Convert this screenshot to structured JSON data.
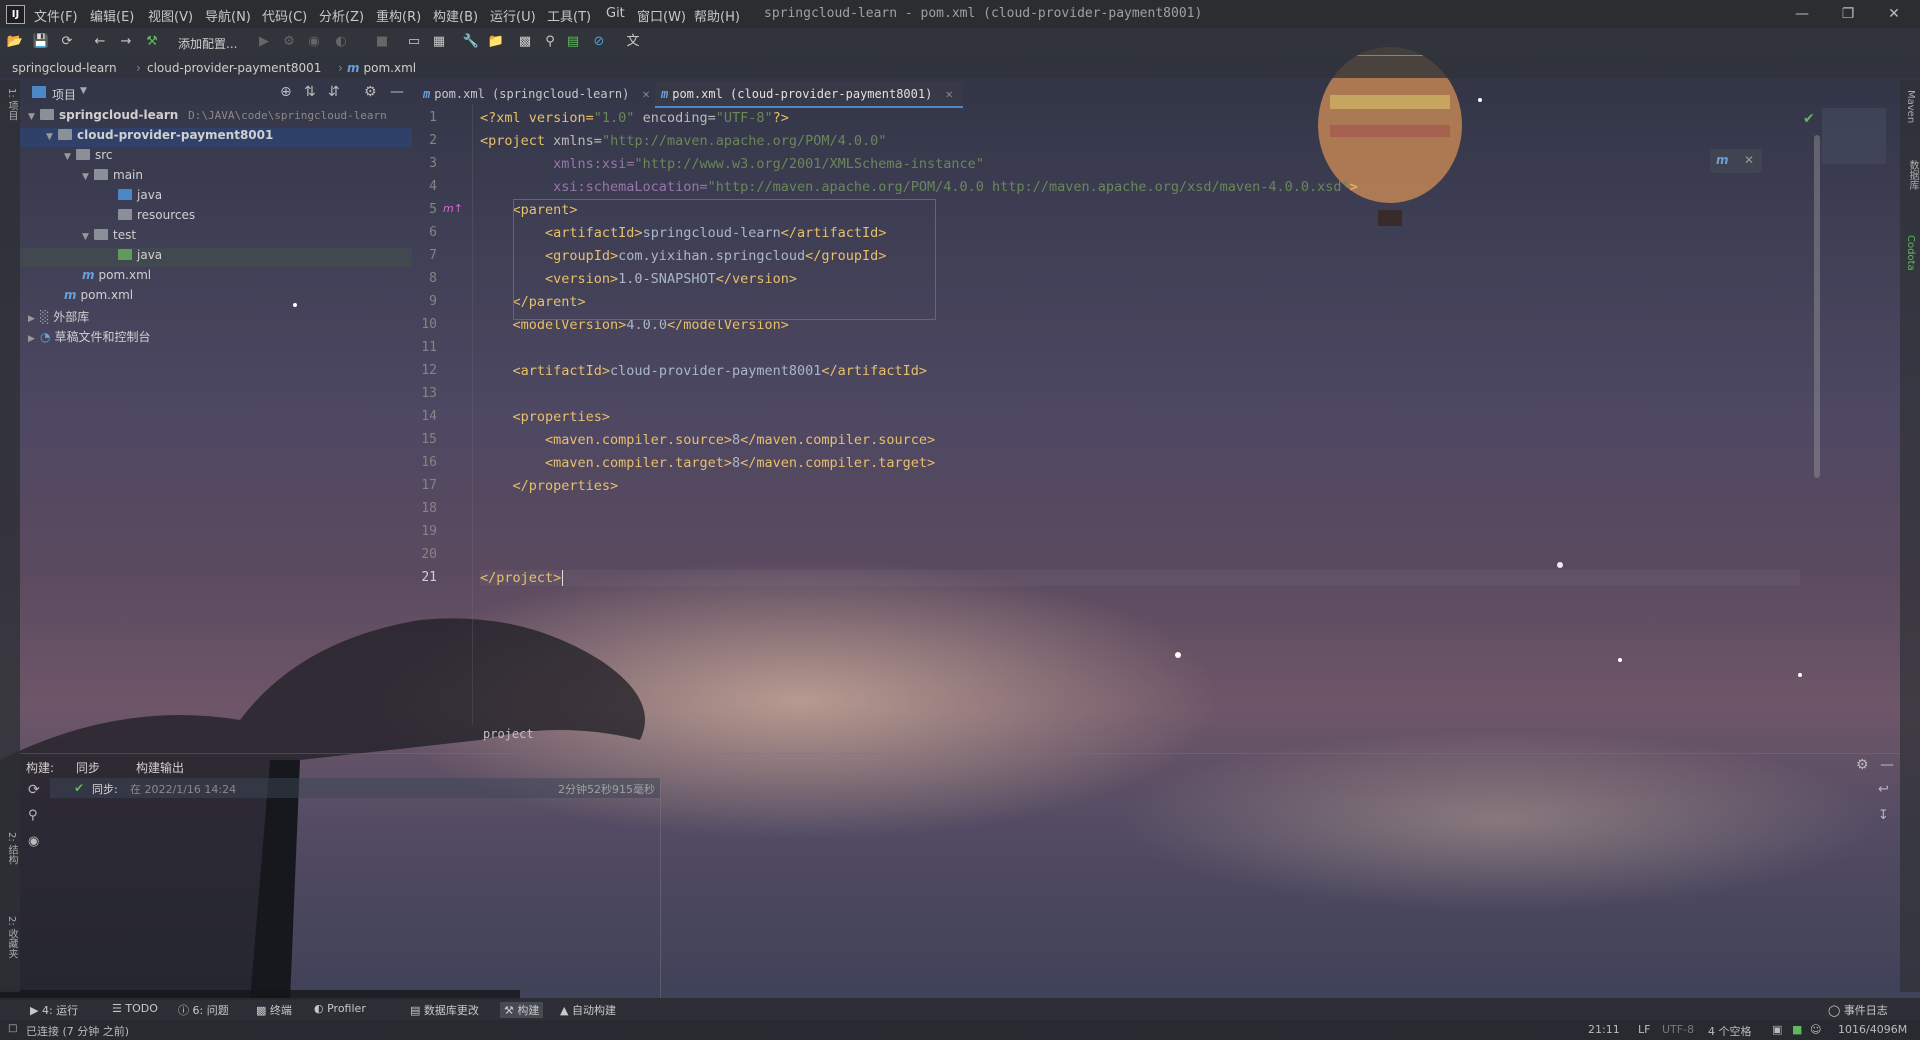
{
  "window": {
    "title": "springcloud-learn - pom.xml (cloud-provider-payment8001)",
    "logo": "IJ"
  },
  "menu": [
    "文件(F)",
    "编辑(E)",
    "视图(V)",
    "导航(N)",
    "代码(C)",
    "分析(Z)",
    "重构(R)",
    "构建(B)",
    "运行(U)",
    "工具(T)",
    "Git",
    "窗口(W)",
    "帮助(H)"
  ],
  "toolbar": {
    "add_config": "添加配置..."
  },
  "breadcrumb": [
    "springcloud-learn",
    "cloud-provider-payment8001",
    "pom.xml"
  ],
  "left_strip": {
    "project_label": "1: 项目",
    "structure_label": "2: 结构",
    "favorites_label": "2: 收藏夹"
  },
  "right_strip": {
    "maven_label": "Maven",
    "database_label": "数据库",
    "codota_label": "Codota"
  },
  "project_panel": {
    "title": "项目",
    "tree": [
      {
        "label": "springcloud-learn",
        "extra": "D:\\JAVA\\code\\springcloud-learn"
      },
      {
        "label": "cloud-provider-payment8001"
      },
      {
        "label": "src"
      },
      {
        "label": "main"
      },
      {
        "label": "java"
      },
      {
        "label": "resources"
      },
      {
        "label": "test"
      },
      {
        "label": "java"
      },
      {
        "label": "pom.xml"
      },
      {
        "label": "pom.xml"
      },
      {
        "label": "外部库"
      },
      {
        "label": "草稿文件和控制台"
      }
    ]
  },
  "editor": {
    "tabs": [
      {
        "label": "pom.xml (springcloud-learn)"
      },
      {
        "label": "pom.xml (cloud-provider-payment8001)"
      }
    ],
    "line_numbers": [
      "1",
      "2",
      "3",
      "4",
      "5",
      "6",
      "7",
      "8",
      "9",
      "10",
      "11",
      "12",
      "13",
      "14",
      "15",
      "16",
      "17",
      "18",
      "19",
      "20",
      "21"
    ],
    "lines": [
      {
        "p1": "<?xml version=",
        "p2": "\"1.0\"",
        "p3": " encoding=",
        "p4": "\"UTF-8\"",
        "p5": "?>"
      },
      {
        "p1": "<project ",
        "p2": "xmlns=",
        "p3": "\"http://maven.apache.org/POM/4.0.0\""
      },
      {
        "p1": "         xmlns:xsi=",
        "p2": "\"http://www.w3.org/2001/XMLSchema-instance\""
      },
      {
        "p1": "         xsi:schemaLocation=",
        "p2": "\"http://maven.apache.org/POM/4.0.0 http://maven.apache.org/xsd/maven-4.0.0.xsd\"",
        "p3": ">"
      },
      {
        "p1": "    <parent>"
      },
      {
        "p1": "        <artifactId>",
        "p2": "springcloud-learn",
        "p3": "</artifactId>"
      },
      {
        "p1": "        <groupId>",
        "p2": "com.yixihan.springcloud",
        "p3": "</groupId>"
      },
      {
        "p1": "        <version>",
        "p2": "1.0-SNAPSHOT",
        "p3": "</version>"
      },
      {
        "p1": "    </parent>"
      },
      {
        "p1": "    <modelVersion>",
        "p2": "4.0.0",
        "p3": "</modelVersion>"
      },
      {
        "p1": ""
      },
      {
        "p1": "    <artifactId>",
        "p2": "cloud-provider-payment8001",
        "p3": "</artifactId>"
      },
      {
        "p1": ""
      },
      {
        "p1": "    <properties>"
      },
      {
        "p1": "        <maven.compiler.source>",
        "p2": "8",
        "p3": "</maven.compiler.source>"
      },
      {
        "p1": "        <maven.compiler.target>",
        "p2": "8",
        "p3": "</maven.compiler.target>"
      },
      {
        "p1": "    </properties>"
      },
      {
        "p1": ""
      },
      {
        "p1": ""
      },
      {
        "p1": ""
      },
      {
        "p1": "</project>"
      }
    ],
    "bottom_breadcrumb": "project"
  },
  "build_panel": {
    "label": "构建:",
    "tab_sync": "同步",
    "tab_output": "构建输出",
    "entry_label": "同步:",
    "entry_time": "在 2022/1/16 14:24",
    "entry_duration": "2分钟52秒915毫秒"
  },
  "tool_tabs": [
    "4: 运行",
    "TODO",
    "6: 问题",
    "终端",
    "Profiler",
    "数据库更改",
    "构建",
    "自动构建"
  ],
  "event_log": "事件日志",
  "status": {
    "left": "已连接 (7 分钟 之前)",
    "position": "21:11",
    "line_sep": "LF",
    "encoding": "UTF-8",
    "indent": "4 个空格",
    "memory": "1016/4096M"
  },
  "colors": {
    "accent": "#4a88c7",
    "highlight_box": "#d23a3a",
    "xml_tag": "#e8bf6a",
    "xml_value": "#6a8759"
  }
}
